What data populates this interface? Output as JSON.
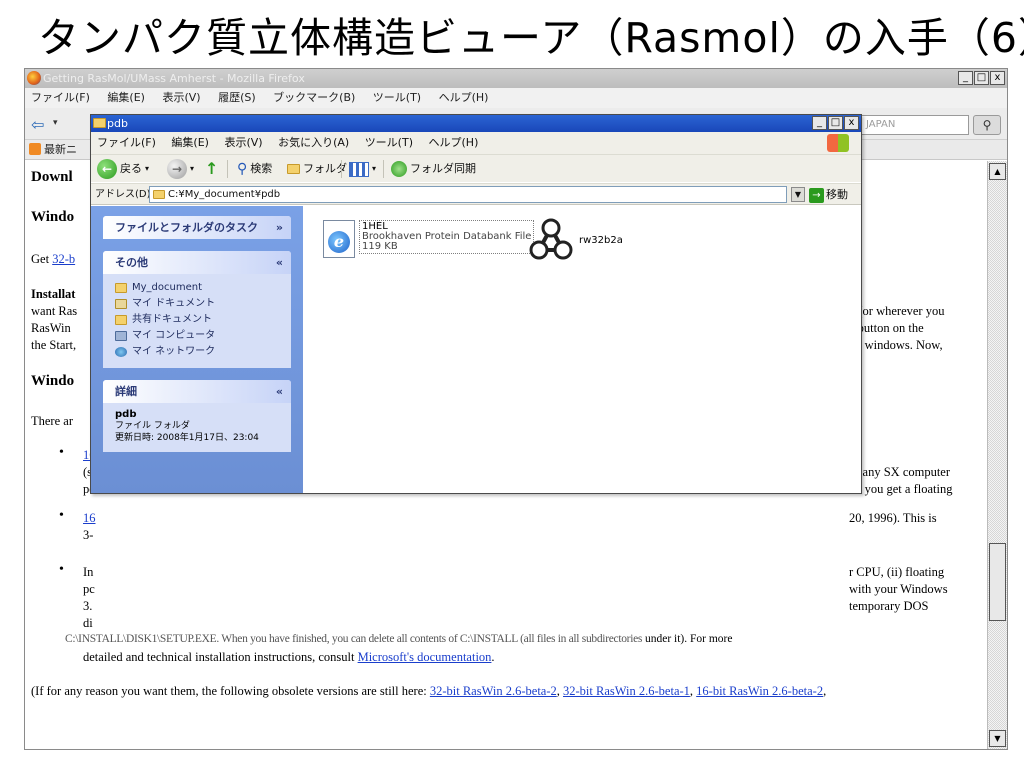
{
  "slide": {
    "title": "タンパク質立体構造ビューア（Rasmol）の入手（6）"
  },
  "browser": {
    "title": "Getting RasMol/UMass Amherst - Mozilla Firefox",
    "window_buttons": [
      "_",
      "□",
      "x"
    ],
    "menu": [
      "ファイル(F)",
      "編集(E)",
      "表示(V)",
      "履歴(S)",
      "ブックマーク(B)",
      "ツール(T)",
      "ヘルプ(H)"
    ],
    "search_text": "JAPAN",
    "bookmark_label": "最新ニ",
    "content": {
      "heading1": "Downl",
      "heading2": "Windo",
      "get_prefix": "Get ",
      "get_link": "32-b",
      "install_lines": [
        "Installat",
        "want Ras",
        "RasWin",
        "the Start,"
      ],
      "install_right": [
        "y (or wherever you",
        "e button on the",
        "all windows. Now,"
      ],
      "heading3": "Windo",
      "there_are": "There ar",
      "bullet1_link": "16",
      "bullet1_lines": [
        "(s",
        "pc"
      ],
      "bullet1_right": [
        "or any SX computer",
        "nd you get a floating"
      ],
      "bullet2_link": "16",
      "bullet2_line": "3-",
      "bullet2_right": "20, 1996). This is",
      "bullet3_lines": [
        "In",
        "pc",
        "3.",
        "di"
      ],
      "bullet3_right": [
        "r CPU, (ii) floating",
        "with your Windows",
        "temporary DOS"
      ],
      "bullet3_strike": "C:\\INSTALL\\DISK1\\SETUP.EXE. When you have finished, you can delete all contents of C:\\INSTALL (all files in all subdirectories",
      "bullet3_strike_end": " under it). For more",
      "bullet3_last_prefix": "detailed and technical installation instructions, consult ",
      "bullet3_last_link": "Microsoft's documentation",
      "bullet3_last_suffix": ".",
      "bottom_prefix": "(If for any reason you want them, the following obsolete versions are still here: ",
      "bottom_link1": "32-bit RasWin 2.6-beta-2",
      "bottom_link2": "32-bit RasWin 2.6-beta-1",
      "bottom_link3": "16-bit RasWin 2.6-beta-2",
      "bottom_comma": ", "
    }
  },
  "explorer": {
    "title": "pdb",
    "window_buttons": [
      "_",
      "□",
      "x"
    ],
    "menu": [
      "ファイル(F)",
      "編集(E)",
      "表示(V)",
      "お気に入り(A)",
      "ツール(T)",
      "ヘルプ(H)"
    ],
    "toolbar": {
      "back": "戻る",
      "search": "検索",
      "folders": "フォルダ",
      "sync": "フォルダ同期"
    },
    "address_label": "アドレス(D)",
    "address_value": "C:¥My_document¥pdb",
    "go_label": "移動",
    "tasks_panel": {
      "title": "ファイルとフォルダのタスク"
    },
    "other_panel": {
      "title": "その他",
      "items": [
        "My_document",
        "マイ ドキュメント",
        "共有ドキュメント",
        "マイ コンピュータ",
        "マイ ネットワーク"
      ]
    },
    "details_panel": {
      "title": "詳細",
      "name": "pdb",
      "type": "ファイル フォルダ",
      "modified": "更新日時: 2008年1月17日、23:04"
    },
    "files": [
      {
        "name": "1HEL",
        "type": "Brookhaven Protein Databank File",
        "size": "119 KB"
      },
      {
        "name": "rw32b2a"
      }
    ],
    "colors": {
      "titlebar": "#1f4fc3",
      "task_pane": "#7aa1e6"
    }
  }
}
